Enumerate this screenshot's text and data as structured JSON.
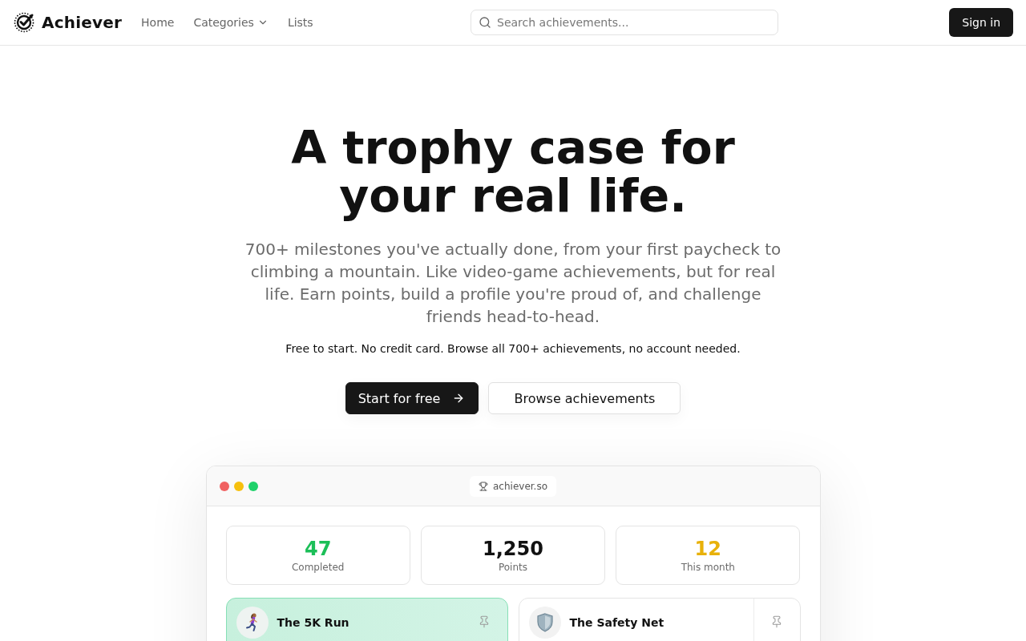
{
  "header": {
    "brand": "Achiever",
    "nav": [
      {
        "label": "Home",
        "kind": "link"
      },
      {
        "label": "Categories",
        "kind": "dropdown"
      },
      {
        "label": "Lists",
        "kind": "link"
      }
    ],
    "search": {
      "placeholder": "Search achievements..."
    },
    "sign_in": "Sign in"
  },
  "hero": {
    "title": "A trophy case for your real life.",
    "subtitle": "700+ milestones you've actually done, from your first paycheck to climbing a mountain. Like video-game achievements, but for real life. Earn points, build a profile you're proud of, and challenge friends head-to-head.",
    "note": "Free to start. No credit card. Browse all 700+ achievements, no account needed.",
    "buttons": [
      {
        "label": "Start for free",
        "kind": "primary"
      },
      {
        "label": "Browse achievements",
        "kind": "secondary"
      }
    ]
  },
  "preview": {
    "window_dots": [
      {
        "color": "#f06161"
      },
      {
        "color": "#f6c00e"
      },
      {
        "color": "#1fd16a"
      }
    ],
    "url": "achiever.so",
    "stats": [
      {
        "value": "47",
        "label": "Completed",
        "color": "#1cbf58"
      },
      {
        "value": "1,250",
        "label": "Points",
        "color": "#111111"
      },
      {
        "value": "12",
        "label": "This month",
        "color": "#e8b10a"
      }
    ],
    "achievements": [
      {
        "title": "The 5K Run",
        "kind": "run",
        "completed": true
      },
      {
        "title": "The Safety Net",
        "kind": "shield",
        "completed": false
      }
    ]
  }
}
